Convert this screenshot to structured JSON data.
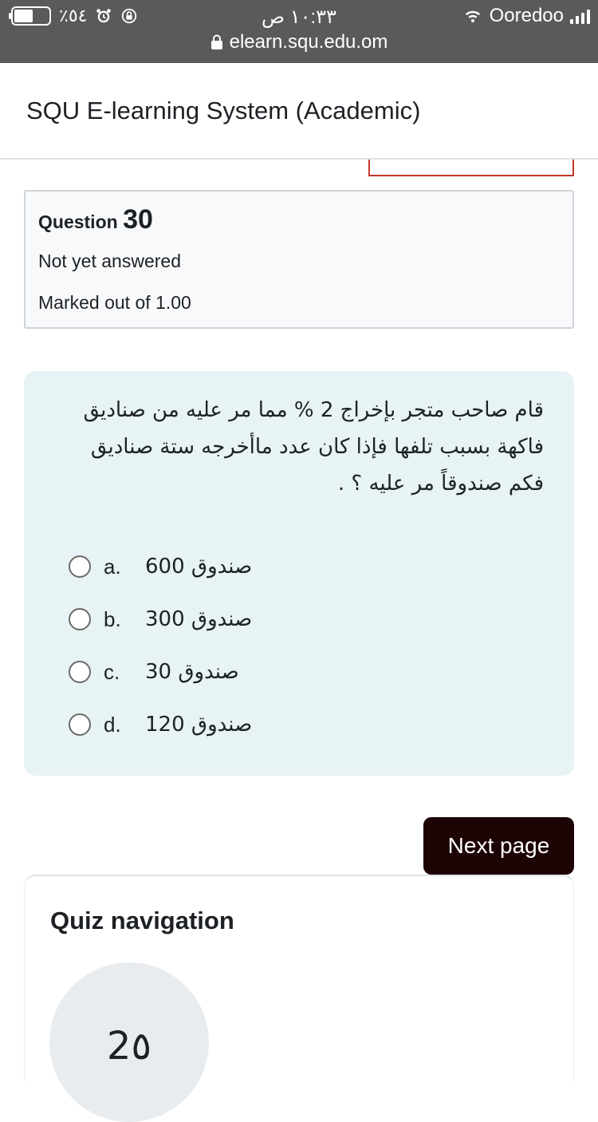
{
  "status_bar": {
    "battery_percent": "٪٥٤",
    "battery_level": 0.54,
    "time": "١٠:٣٣ ص",
    "carrier": "Ooredoo",
    "url": "elearn.squ.edu.om"
  },
  "header": {
    "site_title": "SQU E-learning System (Academic)"
  },
  "question_info": {
    "label": "Question",
    "number": "30",
    "state": "Not yet answered",
    "grade": "Marked out of 1.00"
  },
  "question": {
    "text": "قام صاحب متجر بإخراج 2 % مما مر عليه من صناديق فاكهة بسبب تلفها فإذا كان عدد ماأخرجه ستة صناديق فكم صندوقاً مر عليه ؟ .",
    "answers": [
      {
        "letter": "a.",
        "text": "600 صندوق"
      },
      {
        "letter": "b.",
        "text": "300 صندوق"
      },
      {
        "letter": "c.",
        "text": "30 صندوق"
      },
      {
        "letter": "d.",
        "text": "120 صندوق"
      }
    ]
  },
  "next_button": {
    "label": "Next page"
  },
  "quiz_navigation": {
    "title": "Quiz navigation",
    "current_item": "2٥"
  },
  "colors": {
    "status_bar_bg": "#5a5a5a",
    "question_bg": "#e7f3f5",
    "next_button_bg": "#1d0404",
    "partial_box_border": "#c0392b"
  }
}
